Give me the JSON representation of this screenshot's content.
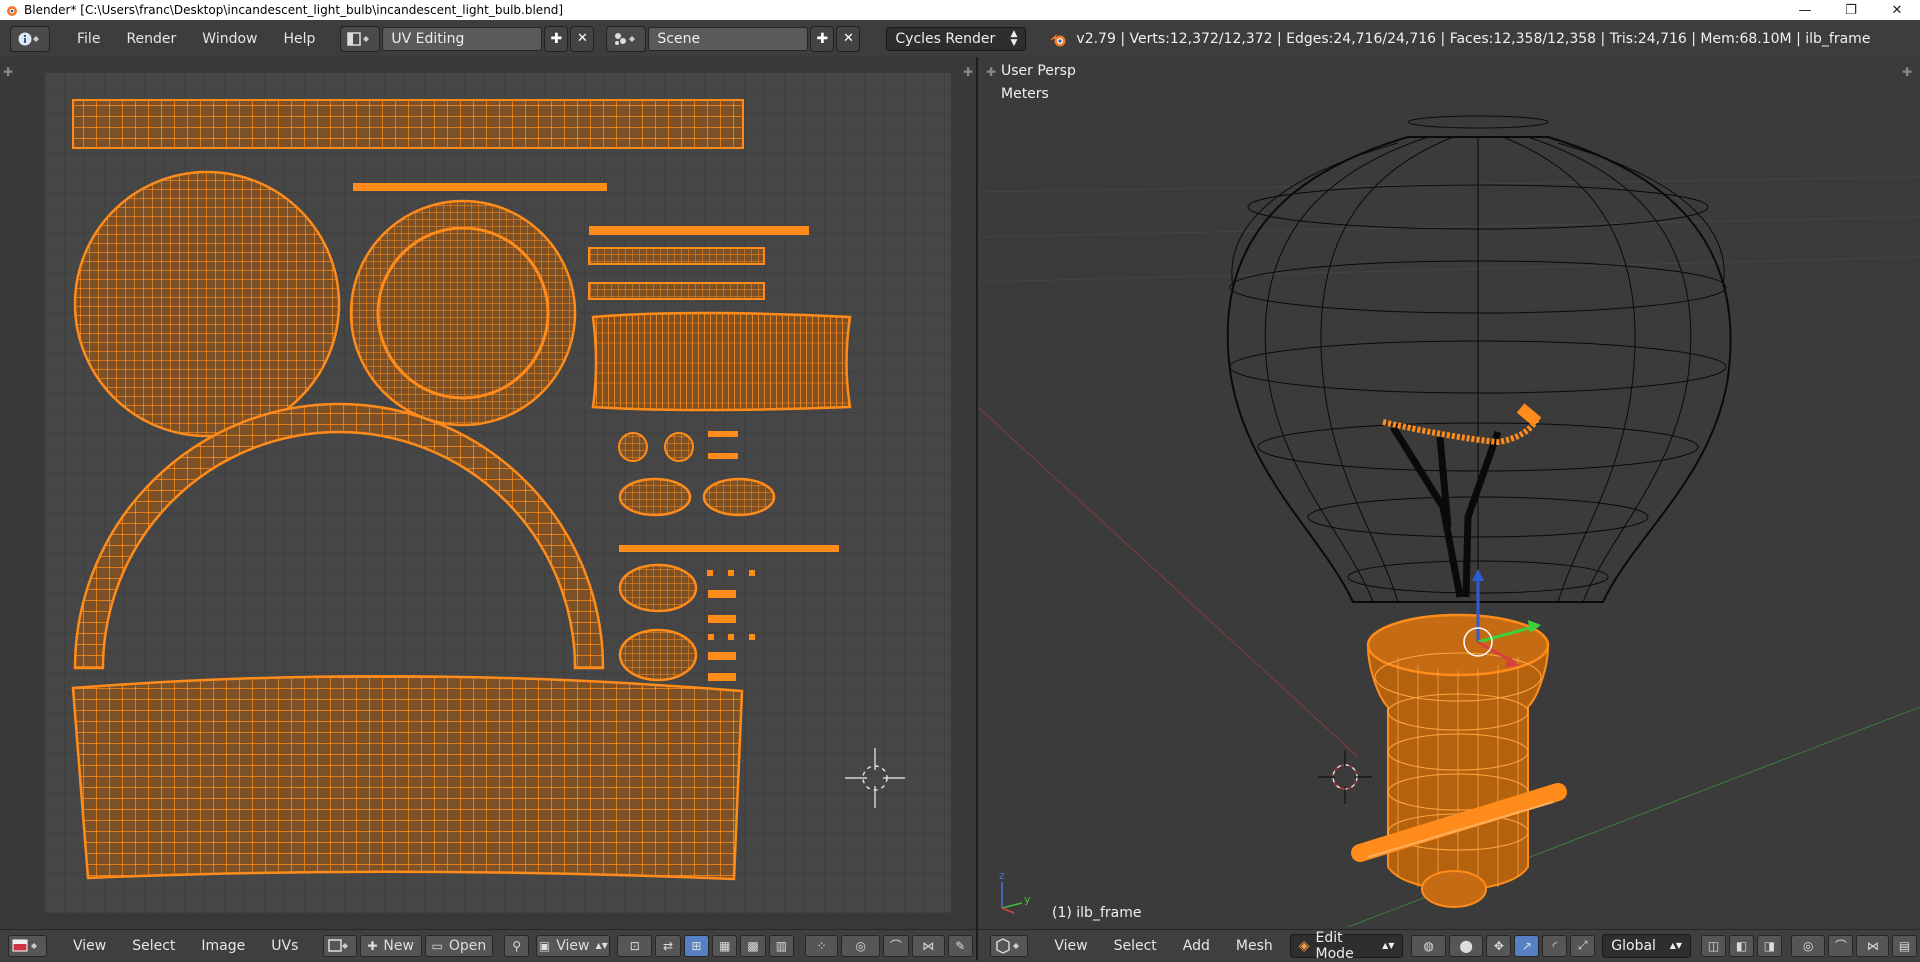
{
  "window": {
    "title": "Blender* [C:\\Users\\franc\\Desktop\\incandescent_light_bulb\\incandescent_light_bulb.blend]",
    "minimize": "—",
    "restore": "❐",
    "close": "✕"
  },
  "info_header": {
    "menus": [
      "File",
      "Render",
      "Window",
      "Help"
    ],
    "screen_layout": "UV Editing",
    "scene": "Scene",
    "render_engine": "Cycles Render",
    "stats": "v2.79 | Verts:12,372/12,372 | Edges:24,716/24,716 | Faces:12,358/12,358 | Tris:24,716 | Mem:68.10M | ilb_frame"
  },
  "uv_editor": {
    "header": {
      "menus": [
        "View",
        "Select",
        "Image",
        "UVs"
      ],
      "new_label": "New",
      "open_label": "Open",
      "view_label": "View"
    }
  },
  "viewport": {
    "view_name": "User Persp",
    "units": "Meters",
    "object_label": "(1) ilb_frame",
    "header": {
      "menus": [
        "View",
        "Select",
        "Add",
        "Mesh"
      ],
      "mode": "Edit Mode",
      "orientation": "Global"
    }
  },
  "colors": {
    "uv_orange": "#ff8c1a",
    "background": "#393939",
    "grid_bg": "#444444",
    "accent_blue": "#5680c2"
  },
  "icons": {
    "blender_logo": "blender-logo-icon",
    "info": "info-icon",
    "cursor_3d": "3d-cursor-icon"
  }
}
